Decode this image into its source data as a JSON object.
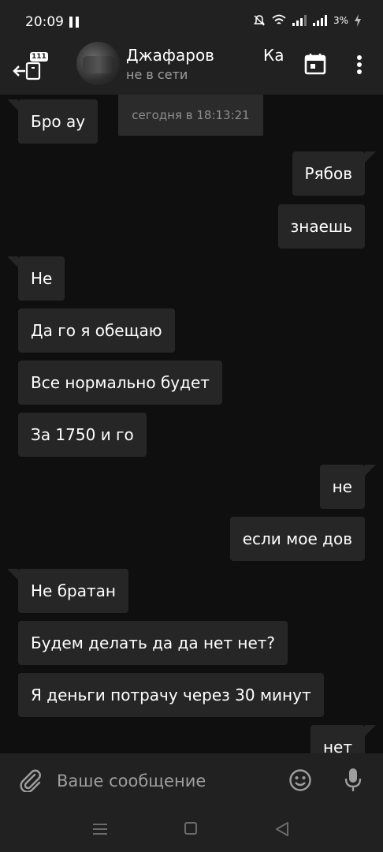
{
  "status_bar": {
    "time": "20:09",
    "battery": "3%"
  },
  "header": {
    "contact_name": "Джафаров",
    "contact_prefix_dim": "",
    "status": "не в сети",
    "overlap_text": "Ка",
    "unread_badge": "111"
  },
  "date_label": "сегодня в 18:13:21",
  "messages": [
    {
      "dir": "in",
      "text": "Бро ау"
    },
    {
      "dir": "out",
      "text": "Рябов"
    },
    {
      "dir": "out",
      "text": "знаешь"
    },
    {
      "dir": "in",
      "text": "Не"
    },
    {
      "dir": "in",
      "text": "Да го я обещаю"
    },
    {
      "dir": "in",
      "text": "Все нормально будет"
    },
    {
      "dir": "in",
      "text": "За 1750 и го"
    },
    {
      "dir": "out",
      "text": "не"
    },
    {
      "dir": "out",
      "text": "если мое дов"
    },
    {
      "dir": "in",
      "text": "Не братан"
    },
    {
      "dir": "in",
      "text": "Будем делать да да нет нет?"
    },
    {
      "dir": "in",
      "text": "Я деньги потрачу через 30 минут"
    },
    {
      "dir": "out",
      "text": "нет"
    }
  ],
  "composer": {
    "placeholder": "Ваше сообщение"
  },
  "icons": {
    "back": "back-arrow-icon",
    "calendar": "calendar-icon",
    "more": "more-vert-icon",
    "attach": "paperclip-icon",
    "emoji": "emoji-icon",
    "mic": "mic-icon"
  }
}
